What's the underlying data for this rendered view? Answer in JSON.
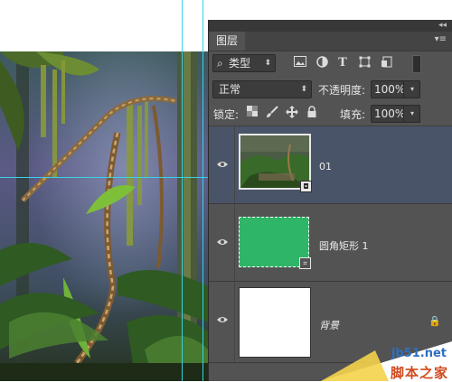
{
  "panel": {
    "tab_label": "图层",
    "filter": {
      "label": "类型"
    },
    "blend_mode": "正常",
    "opacity_label": "不透明度:",
    "opacity_value": "100%",
    "lock_label": "锁定:",
    "fill_label": "填充:",
    "fill_value": "100%",
    "layers": [
      {
        "name": "01",
        "selected": true,
        "kind": "smart-object"
      },
      {
        "name": "圆角矩形 1",
        "selected": false,
        "kind": "shape",
        "fill_color": "#2fb568"
      },
      {
        "name": "背景",
        "selected": false,
        "kind": "background",
        "fill_color": "#ffffff"
      }
    ]
  },
  "watermark": {
    "url": "jb51.net",
    "cn": "脚本之家"
  },
  "colors": {
    "panel_bg": "#535353",
    "selected_row": "#4a5468",
    "guide": "#37d3e6"
  }
}
